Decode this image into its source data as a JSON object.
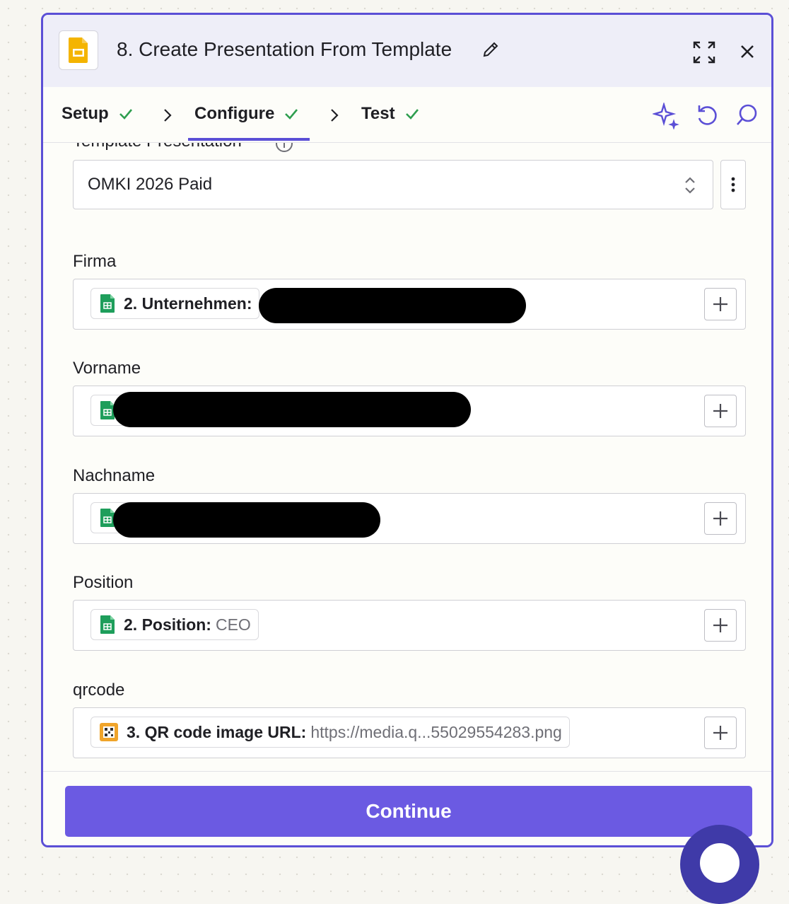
{
  "header": {
    "title": "8. Create Presentation From Template",
    "app_icon": "google-slides-icon",
    "accent_color": "#5b4fd6"
  },
  "steps": [
    {
      "label": "Setup",
      "done": true
    },
    {
      "label": "Configure",
      "done": true,
      "active": true
    },
    {
      "label": "Test",
      "done": true
    }
  ],
  "toolbar": {
    "icons": [
      "sparkle-icon",
      "undo-icon",
      "search-icon"
    ]
  },
  "form": {
    "template_label": "Template Presentation",
    "template_value": "OMKI 2026 Paid",
    "fields": [
      {
        "label": "Firma",
        "chip_label": "2. Unternehmen:",
        "chip_value": "",
        "redacted": true
      },
      {
        "label": "Vorname",
        "chip_label": "",
        "chip_value": "",
        "redacted": true
      },
      {
        "label": "Nachname",
        "chip_label": "",
        "chip_value": "",
        "redacted": true
      },
      {
        "label": "Position",
        "chip_label": "2. Position:",
        "chip_value": "CEO",
        "redacted": false
      },
      {
        "label": "qrcode",
        "chip_label": "3. QR code image URL:",
        "chip_value": "https://media.q...55029554283.png",
        "redacted": false
      }
    ]
  },
  "footer": {
    "continue_label": "Continue",
    "button_color": "#6b5ae2"
  }
}
